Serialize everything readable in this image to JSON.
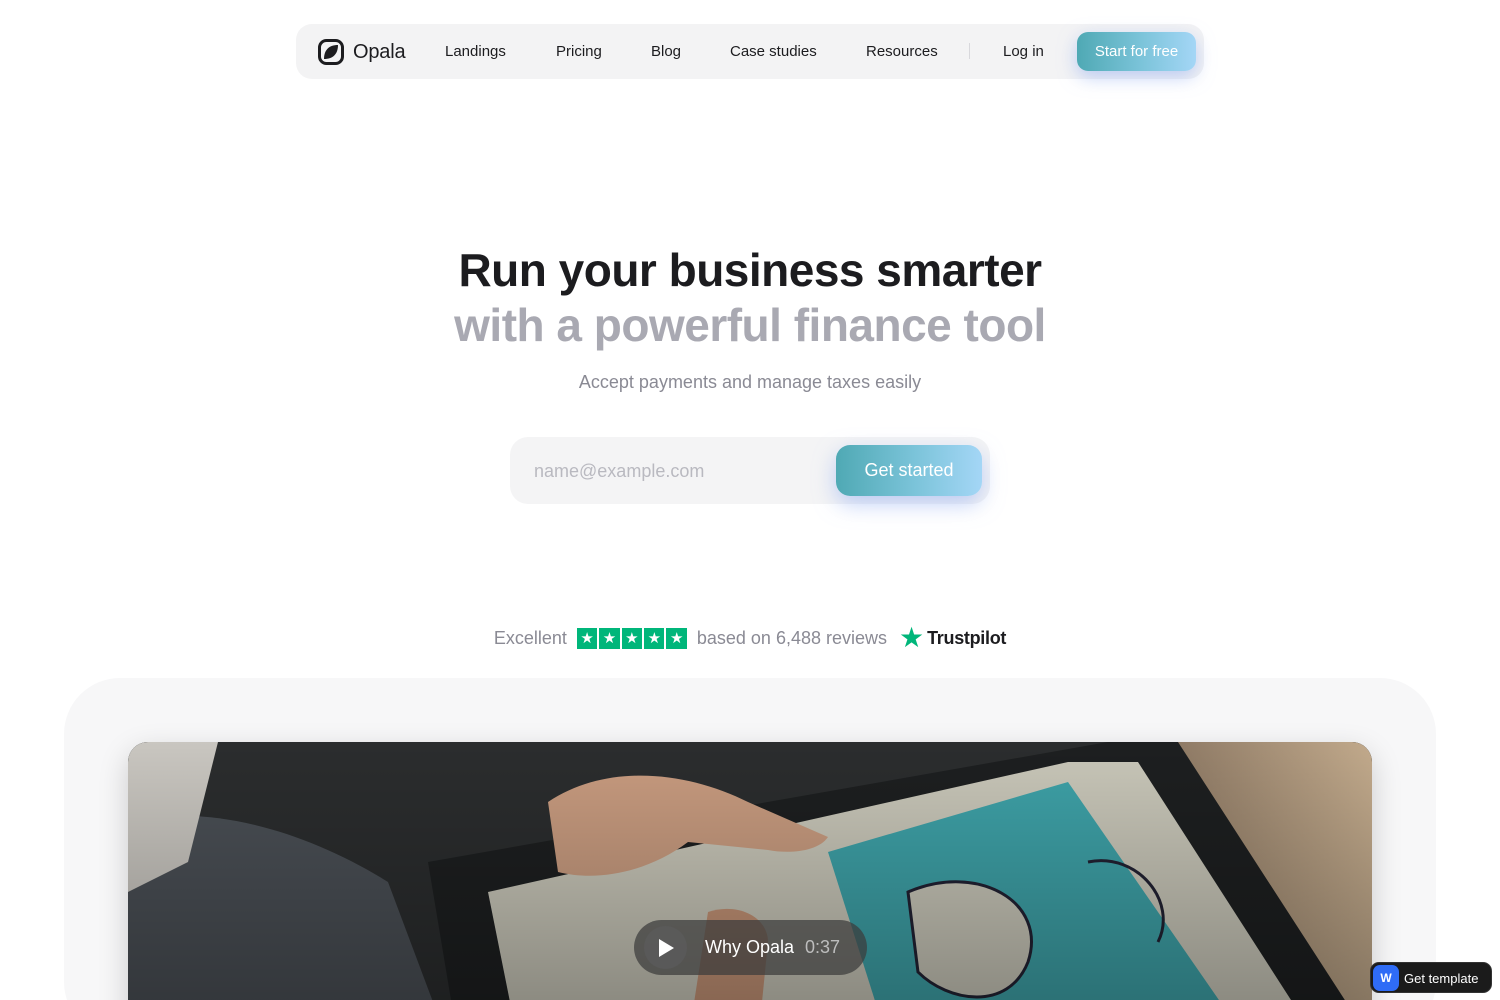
{
  "nav": {
    "logo_text": "Opala",
    "links": [
      "Landings",
      "Pricing",
      "Blog",
      "Case studies",
      "Resources"
    ],
    "login": "Log in",
    "cta": "Start for free"
  },
  "hero": {
    "title_line1": "Run your business smarter",
    "title_line2": "with a powerful finance tool",
    "subtitle": "Accept payments and manage taxes easily"
  },
  "signup": {
    "placeholder": "name@example.com",
    "button": "Get started"
  },
  "reviews": {
    "rating_word": "Excellent",
    "stars": 5,
    "count_text": "based on 6,488 reviews",
    "brand": "Trustpilot"
  },
  "video": {
    "label": "Why Opala",
    "duration": "0:37"
  },
  "badge": {
    "label": "Get template"
  },
  "colors": {
    "accent_from": "#4fa9b4",
    "accent_to": "#a4d6f6",
    "trustpilot_green": "#00b67a",
    "heading": "#1c1c1f",
    "muted_heading": "#a9a9b2"
  },
  "icons": {
    "logo": "opala-leaf-icon",
    "play": "play-icon",
    "trust_star": "trustpilot-star-icon",
    "webflow": "webflow-icon"
  }
}
